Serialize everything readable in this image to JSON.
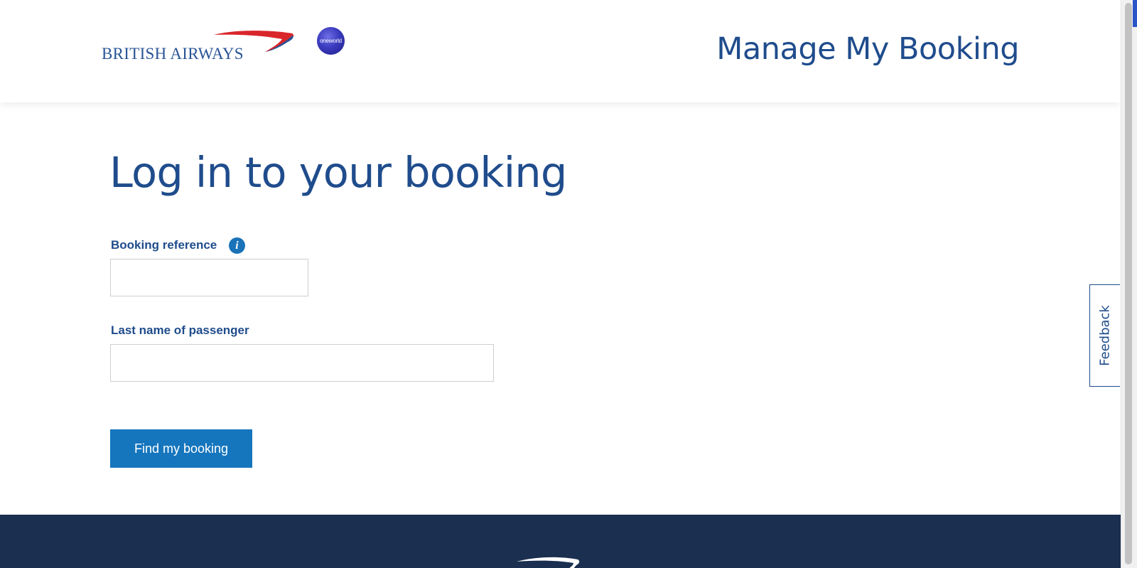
{
  "header": {
    "brand_wordmark": "BRITISH AIRWAYS",
    "alliance_badge": "oneworld",
    "title": "Manage My Booking"
  },
  "main": {
    "heading": "Log in to your booking",
    "booking_reference": {
      "label": "Booking reference",
      "value": "",
      "info_icon": "info-icon"
    },
    "last_name": {
      "label": "Last name of passenger",
      "value": ""
    },
    "submit_label": "Find my booking"
  },
  "feedback": {
    "label": "Feedback"
  },
  "colors": {
    "brand_blue": "#1f4c8c",
    "button_blue": "#1575bd",
    "ribbon_red": "#d9262b",
    "footer_navy": "#1b2f50"
  }
}
